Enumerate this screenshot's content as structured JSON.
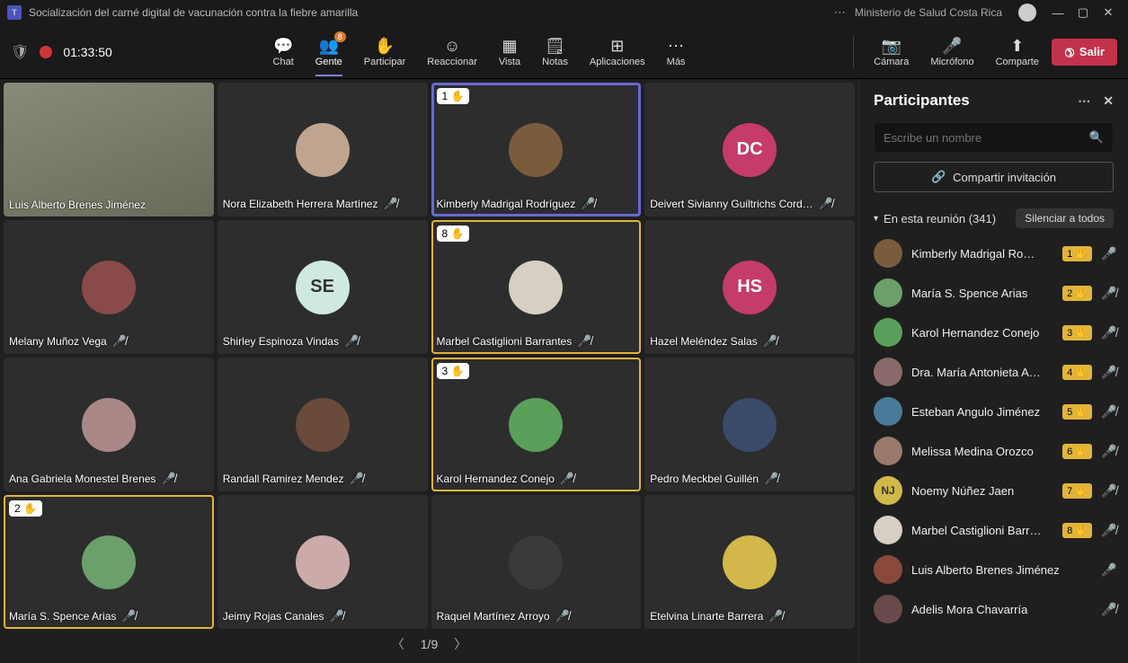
{
  "titleBar": {
    "appIconLetter": "T",
    "meetingTitle": "Socialización del carné digital de vacunación contra la fiebre amarilla",
    "orgName": "Ministerio de Salud Costa Rica"
  },
  "toolbar": {
    "duration": "01:33:50",
    "chat": "Chat",
    "people": "Gente",
    "peopleBadge": "8",
    "raiseHand": "Participar",
    "react": "Reaccionar",
    "view": "Vista",
    "notes": "Notas",
    "apps": "Aplicaciones",
    "more": "Más",
    "camera": "Cámara",
    "mic": "Micrófono",
    "share": "Comparte",
    "leave": "Salir"
  },
  "pager": {
    "current": "1/9"
  },
  "tiles": [
    {
      "name": "Luis Alberto Brenes Jiménez",
      "type": "video",
      "muted": false,
      "hand": null,
      "border": null,
      "avatarBg": "#666"
    },
    {
      "name": "Nora Elizabeth Herrera Martínez",
      "type": "avatar",
      "muted": true,
      "hand": null,
      "border": null,
      "avatarBg": "#bfa490",
      "initials": ""
    },
    {
      "name": "Kimberly Madrigal Rodríguez",
      "type": "avatar",
      "muted": true,
      "hand": "1",
      "border": "blue",
      "avatarBg": "#7a5c3d",
      "initials": ""
    },
    {
      "name": "Deivert Sivianny Guiltrichs Cord…",
      "type": "initials",
      "muted": true,
      "hand": null,
      "border": null,
      "avatarBg": "#c53b6c",
      "initials": "DC"
    },
    {
      "name": "Melany Muñoz Vega",
      "type": "avatar",
      "muted": true,
      "hand": null,
      "border": null,
      "avatarBg": "#8a4a4a",
      "initials": ""
    },
    {
      "name": "Shirley Espinoza Vindas",
      "type": "initials",
      "muted": true,
      "hand": null,
      "border": null,
      "avatarBg": "#cfe8e0",
      "initials": "SE",
      "initialsColor": "#333"
    },
    {
      "name": "Marbel Castiglioni Barrantes",
      "type": "avatar",
      "muted": true,
      "hand": "8",
      "border": "gold",
      "avatarBg": "#d5cfc4",
      "initials": ""
    },
    {
      "name": "Hazel Meléndez Salas",
      "type": "initials",
      "muted": true,
      "hand": null,
      "border": null,
      "avatarBg": "#c53b6c",
      "initials": "HS"
    },
    {
      "name": "Ana Gabriela Monestel Brenes",
      "type": "avatar",
      "muted": true,
      "hand": null,
      "border": null,
      "avatarBg": "#a88",
      "initials": ""
    },
    {
      "name": "Randall Ramirez Mendez",
      "type": "avatar",
      "muted": true,
      "hand": null,
      "border": null,
      "avatarBg": "#6a4a3a",
      "initials": ""
    },
    {
      "name": "Karol Hernandez Conejo",
      "type": "avatar",
      "muted": true,
      "hand": "3",
      "border": "gold",
      "avatarBg": "#5aa05a",
      "initials": ""
    },
    {
      "name": "Pedro Meckbel Guillén",
      "type": "avatar",
      "muted": true,
      "hand": null,
      "border": null,
      "avatarBg": "#3a4a6a",
      "initials": ""
    },
    {
      "name": "María S. Spence Arias",
      "type": "avatar",
      "muted": true,
      "hand": "2",
      "border": "gold",
      "avatarBg": "#6aa06a",
      "initials": ""
    },
    {
      "name": "Jeimy Rojas Canales",
      "type": "avatar",
      "muted": true,
      "hand": null,
      "border": null,
      "avatarBg": "#caa",
      "initials": ""
    },
    {
      "name": "Raquel Martínez Arroyo",
      "type": "avatar",
      "muted": true,
      "hand": null,
      "border": null,
      "avatarBg": "#3a3a3a",
      "initials": ""
    },
    {
      "name": "Etelvina Linarte Barrera",
      "type": "avatar",
      "muted": true,
      "hand": null,
      "border": null,
      "avatarBg": "#d2b84a",
      "initials": ""
    }
  ],
  "panel": {
    "title": "Participantes",
    "searchPlaceholder": "Escribe un nombre",
    "shareInvite": "Compartir invitación",
    "sectionLabel": "En esta reunión (341)",
    "muteAll": "Silenciar a todos",
    "rows": [
      {
        "name": "Kimberly Madrigal Ro…",
        "hand": "1",
        "mic": "on",
        "avatarBg": "#7a5c3d",
        "initials": ""
      },
      {
        "name": "María S. Spence Arias",
        "hand": "2",
        "mic": "mute",
        "avatarBg": "#6aa06a",
        "initials": ""
      },
      {
        "name": "Karol Hernandez Conejo",
        "hand": "3",
        "mic": "mute",
        "avatarBg": "#5aa05a",
        "initials": ""
      },
      {
        "name": "Dra. María Antonieta A…",
        "hand": "4",
        "mic": "mute",
        "avatarBg": "#8a6a6a",
        "initials": ""
      },
      {
        "name": "Esteban Angulo Jiménez",
        "hand": "5",
        "mic": "mute",
        "avatarBg": "#4a7a9a",
        "initials": ""
      },
      {
        "name": "Melissa Medina Orozco",
        "hand": "6",
        "mic": "mute",
        "avatarBg": "#9a7a6a",
        "initials": ""
      },
      {
        "name": "Noemy Núñez Jaen",
        "hand": "7",
        "mic": "mute",
        "avatarBg": "#d2b84a",
        "initials": "NJ",
        "initialsColor": "#333"
      },
      {
        "name": "Marbel Castiglioni Barr…",
        "hand": "8",
        "mic": "mute",
        "avatarBg": "#d5cfc4",
        "initials": ""
      },
      {
        "name": "Luis Alberto Brenes Jiménez",
        "hand": null,
        "mic": "on",
        "avatarBg": "#8a4a3a",
        "initials": ""
      },
      {
        "name": "Adelis Mora Chavarría",
        "hand": null,
        "mic": "mute",
        "avatarBg": "#6a4a4a",
        "initials": ""
      }
    ]
  }
}
